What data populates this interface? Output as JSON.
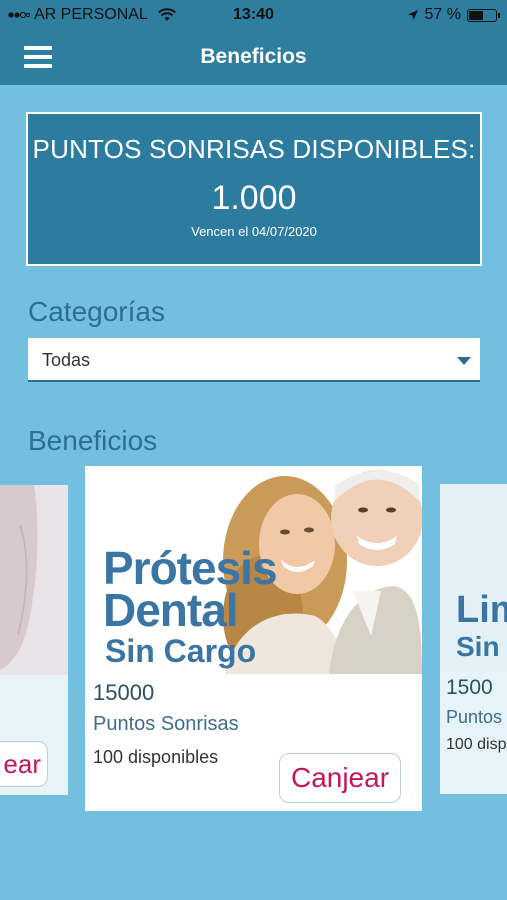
{
  "status": {
    "carrier": "AR PERSONAL",
    "time": "13:40",
    "battery": "57 %",
    "battery_level": 0.57
  },
  "nav": {
    "title": "Beneficios"
  },
  "points": {
    "label": "PUNTOS SONRISAS DISPONIBLES:",
    "value": "1.000",
    "expiry": "Vencen el 04/07/2020"
  },
  "categories": {
    "title": "Categorías",
    "selected": "Todas"
  },
  "benefits": {
    "title": "Beneficios",
    "left_card": {
      "button_label": "ear"
    },
    "main_card": {
      "image_text_line1": "Prótesis",
      "image_text_line2": "Dental",
      "image_text_line3": "Sin Cargo",
      "points": "15000",
      "points_label": "Puntos Sonrisas",
      "available": "100 disponibles",
      "button_label": "Canjear"
    },
    "right_card": {
      "image_text_line1": "Lim",
      "image_text_line2": "Sin",
      "points": "1500",
      "points_label": "Puntos",
      "available": "100 disp"
    }
  },
  "colors": {
    "background": "#72bfe0",
    "header": "#2e7ea0",
    "accent_text": "#2d6f93",
    "button_text": "#c2185b"
  }
}
